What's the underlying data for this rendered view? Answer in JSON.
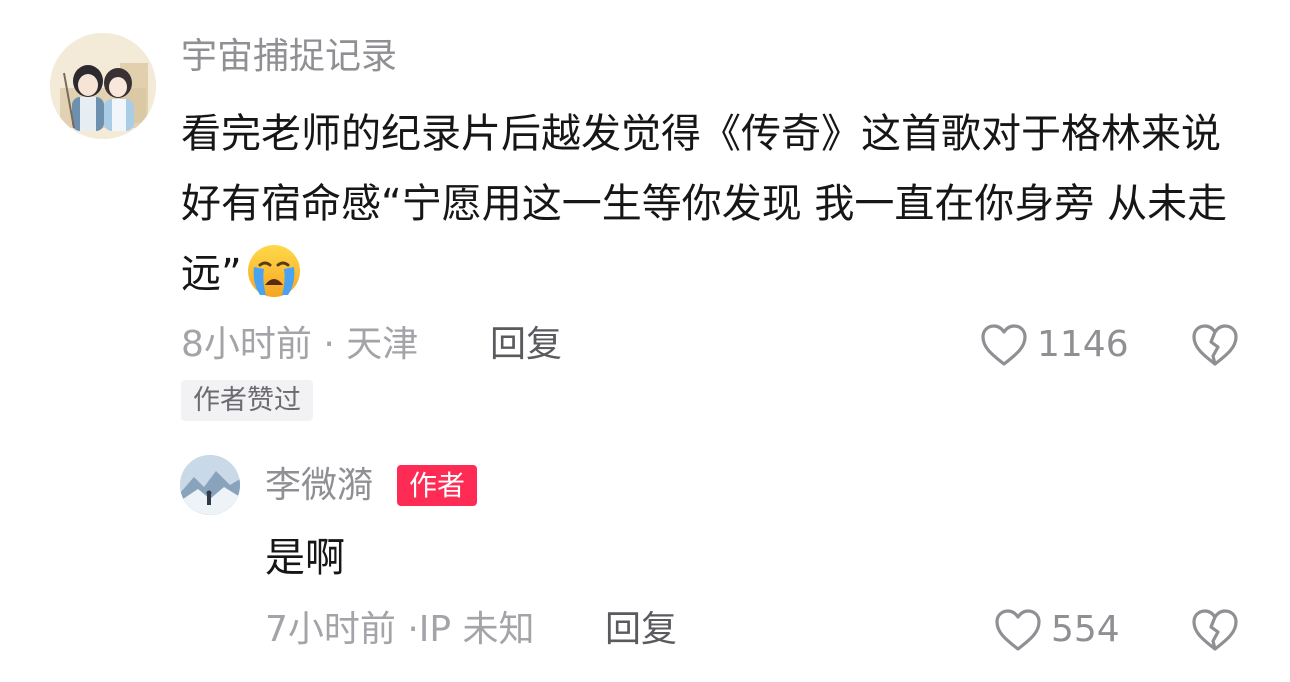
{
  "main_comment": {
    "author": "宇宙捕捉记录",
    "content": "看完老师的纪录片后越发觉得《传奇》这首歌对于格林来说好有宿命感“宁愿用这一生等你发现 我一直在你身旁 从未走远”",
    "emoji": "loudly-crying-face",
    "meta": "8小时前 · 天津",
    "reply_label": "回复",
    "like_count": "1146",
    "liked_badge": "作者赞过"
  },
  "reply_comment": {
    "author": "李微漪",
    "author_tag": "作者",
    "content": "是啊",
    "meta": "7小时前 ·IP 未知",
    "reply_label": "回复",
    "like_count": "554"
  },
  "colors": {
    "author_tag_bg": "#fe2c55",
    "meta_text": "#a3a3a8",
    "icon_stroke": "#8f8f94"
  }
}
